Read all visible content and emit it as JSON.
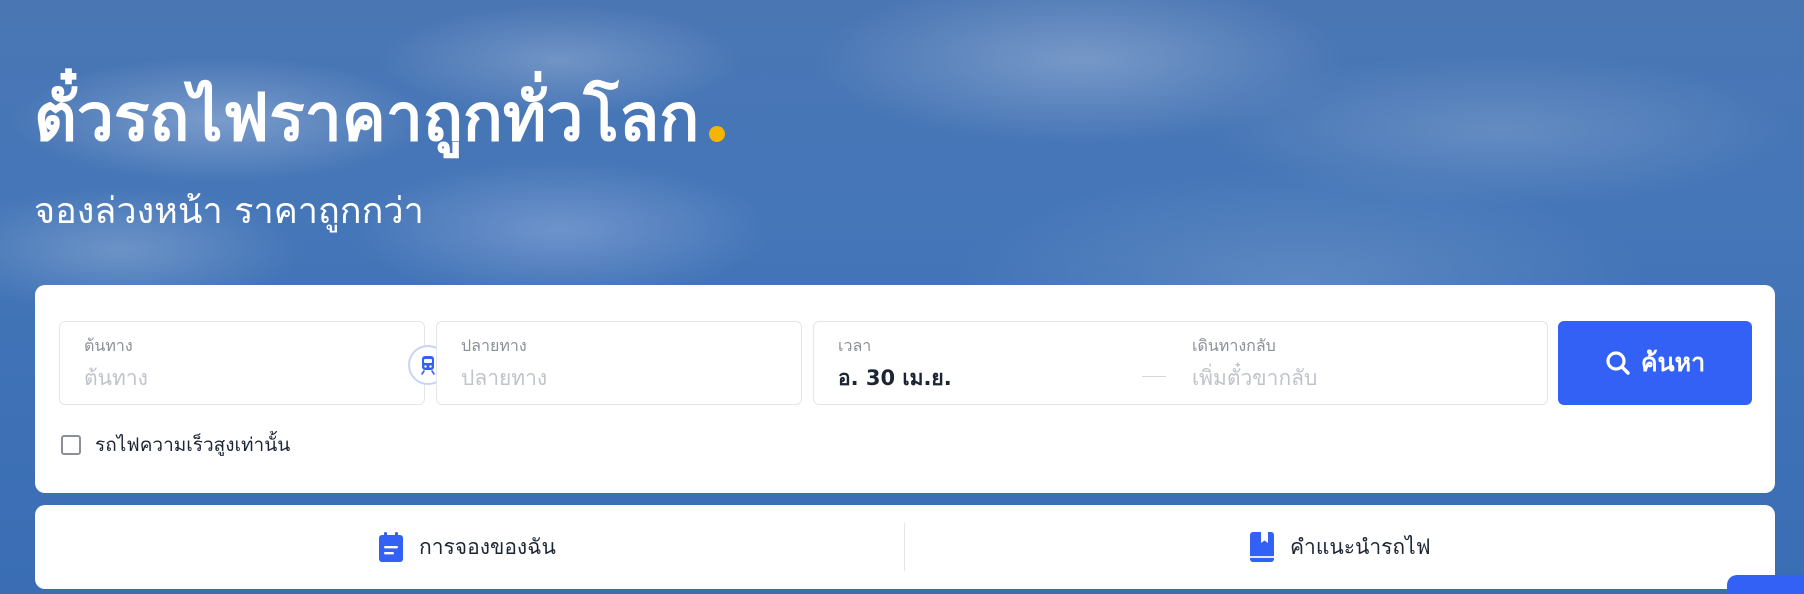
{
  "hero": {
    "title": "ตั๋วรถไฟราคาถูกทั่วโลก",
    "subtitle": "จองล่วงหน้า ราคาถูกกว่า"
  },
  "search": {
    "origin": {
      "label": "ต้นทาง",
      "placeholder": "ต้นทาง"
    },
    "destination": {
      "label": "ปลายทาง",
      "placeholder": "ปลายทาง"
    },
    "time": {
      "label": "เวลา",
      "value": "อ. 30 เม.ย."
    },
    "return": {
      "label": "เดินทางกลับ",
      "placeholder": "เพิ่มตั๋วขากลับ"
    },
    "search_button": "ค้นหา",
    "high_speed_only": {
      "label": "รถไฟความเร็วสูงเท่านั้น",
      "checked": false
    }
  },
  "links": {
    "my_bookings": "การจองของฉัน",
    "train_guide": "คำแนะนำรถไฟ"
  },
  "colors": {
    "accent": "#3461f5",
    "title_dot": "#f5b400",
    "icons": [
      "train-icon",
      "search-icon",
      "clipboard-icon",
      "book-icon"
    ]
  }
}
